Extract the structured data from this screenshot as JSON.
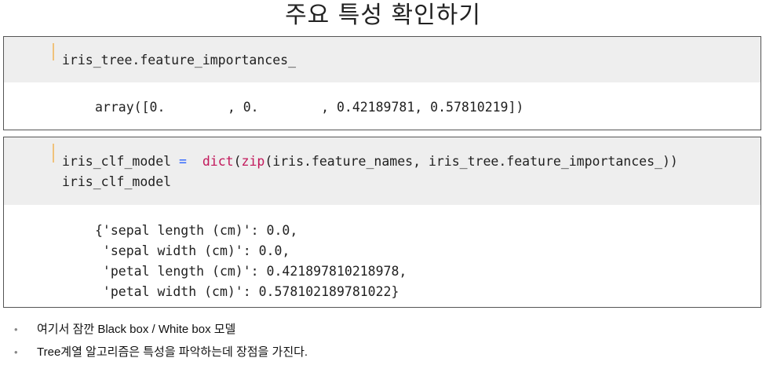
{
  "page": {
    "title": "주요 특성 확인하기"
  },
  "cell1": {
    "input_line": "iris_tree.feature_importances_",
    "output_line": "array([0.        , 0.        , 0.42189781, 0.57810219])"
  },
  "cell2": {
    "input_var": "iris_clf_model",
    "input_eq": " = ",
    "input_fn": "dict",
    "input_paren": "(",
    "input_zip": "zip",
    "input_args": "(iris.feature_names, iris_tree.feature_importances_))",
    "input_line2": "iris_clf_model",
    "output_lines": [
      "{'sepal length (cm)': 0.0,",
      " 'sepal width (cm)': 0.0,",
      " 'petal length (cm)': 0.421897810218978,",
      " 'petal width (cm)': 0.578102189781022}"
    ]
  },
  "bullets": [
    "여기서 잠깐 Black box / White box 모델",
    "Tree계열 알고리즘은 특성을 파악하는데 장점을 가진다."
  ],
  "colors": {
    "keyword": "#2962ff",
    "function": "#c2185b",
    "cell_bar": "#f0c27b",
    "input_bg": "#eeeeee"
  }
}
